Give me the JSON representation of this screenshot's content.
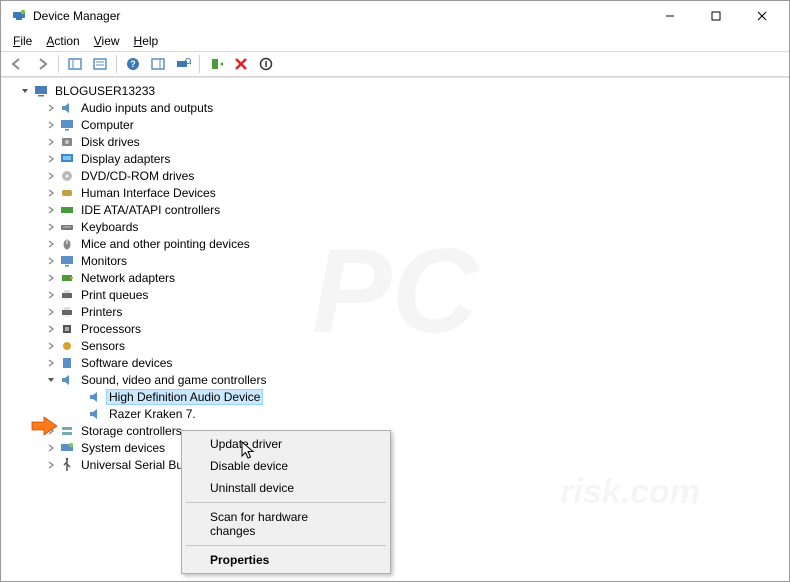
{
  "title": "Device Manager",
  "menubar": {
    "file": "File",
    "action": "Action",
    "view": "View",
    "help": "Help"
  },
  "root": "BLOGUSER13233",
  "nodes": [
    {
      "label": "Audio inputs and outputs",
      "icon": "speaker"
    },
    {
      "label": "Computer",
      "icon": "monitor"
    },
    {
      "label": "Disk drives",
      "icon": "disk"
    },
    {
      "label": "Display adapters",
      "icon": "display"
    },
    {
      "label": "DVD/CD-ROM drives",
      "icon": "disc"
    },
    {
      "label": "Human Interface Devices",
      "icon": "hid"
    },
    {
      "label": "IDE ATA/ATAPI controllers",
      "icon": "ata"
    },
    {
      "label": "Keyboards",
      "icon": "keyboard"
    },
    {
      "label": "Mice and other pointing devices",
      "icon": "mouse"
    },
    {
      "label": "Monitors",
      "icon": "monitor2"
    },
    {
      "label": "Network adapters",
      "icon": "nic"
    },
    {
      "label": "Print queues",
      "icon": "printer"
    },
    {
      "label": "Printers",
      "icon": "printer"
    },
    {
      "label": "Processors",
      "icon": "cpu"
    },
    {
      "label": "Sensors",
      "icon": "sensor"
    },
    {
      "label": "Software devices",
      "icon": "soft"
    }
  ],
  "soundCat": {
    "label": "Sound, video and game controllers",
    "icon": "speaker"
  },
  "soundChildren": [
    {
      "label": "High Definition Audio Device",
      "icon": "speaker",
      "selected": true
    },
    {
      "label": "Razer Kraken 7.",
      "icon": "speaker"
    }
  ],
  "tail": [
    {
      "label": "Storage controllers",
      "icon": "storage"
    },
    {
      "label": "System devices",
      "icon": "system"
    },
    {
      "label": "Universal Serial Bu",
      "icon": "usb"
    }
  ],
  "ctx": {
    "update": "Update driver",
    "disable": "Disable device",
    "uninstall": "Uninstall device",
    "scan": "Scan for hardware changes",
    "props": "Properties"
  },
  "watermark": {
    "big": "PC",
    "sub": "risk.com"
  }
}
